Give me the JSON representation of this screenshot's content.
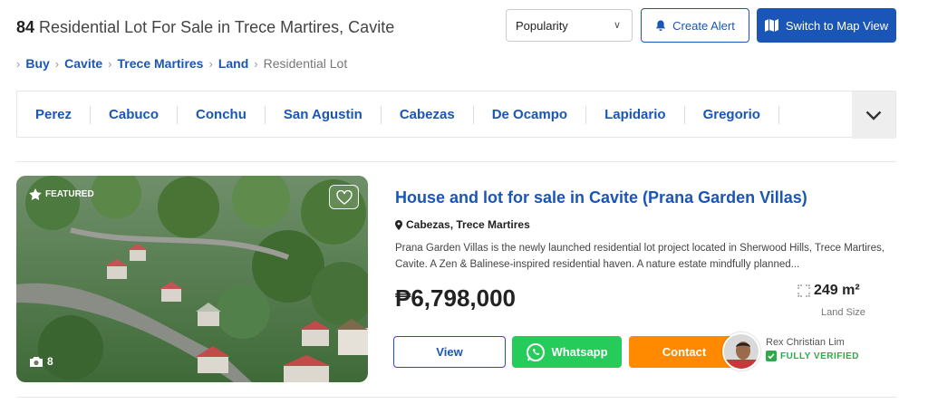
{
  "header": {
    "count": "84",
    "title": "Residential Lot For Sale in Trece Martires, Cavite",
    "sort_value": "Popularity",
    "alert_label": "Create Alert",
    "map_label": "Switch to Map View"
  },
  "breadcrumb": {
    "items": [
      "Buy",
      "Cavite",
      "Trece Martires",
      "Land",
      "Residential Lot"
    ]
  },
  "locations": [
    "Perez",
    "Cabuco",
    "Conchu",
    "San Agustin",
    "Cabezas",
    "De Ocampo",
    "Lapidario",
    "Gregorio"
  ],
  "listing": {
    "featured_label": "FEATURED",
    "photo_count": "8",
    "title": "House and lot for sale in Cavite (Prana Garden Villas)",
    "location": "Cabezas, Trece Martires",
    "description": "Prana Garden Villas is the newly launched residential lot project located in Sherwood Hills, Trece Martires, Cavite. A Zen & Balinese-inspired residential haven. A nature estate mindfully planned...",
    "price": "₱6,798,000",
    "land_size": "249 m²",
    "land_size_label": "Land Size",
    "view_label": "View",
    "whatsapp_label": "Whatsapp",
    "contact_label": "Contact",
    "agent_name": "Rex Christian Lim",
    "verified_label": "FULLY VERIFIED"
  },
  "colors": {
    "brand_blue": "#1a56b7",
    "whatsapp_green": "#25cc5a",
    "contact_orange": "#ff8a00",
    "verified_green": "#2eaa4a"
  }
}
